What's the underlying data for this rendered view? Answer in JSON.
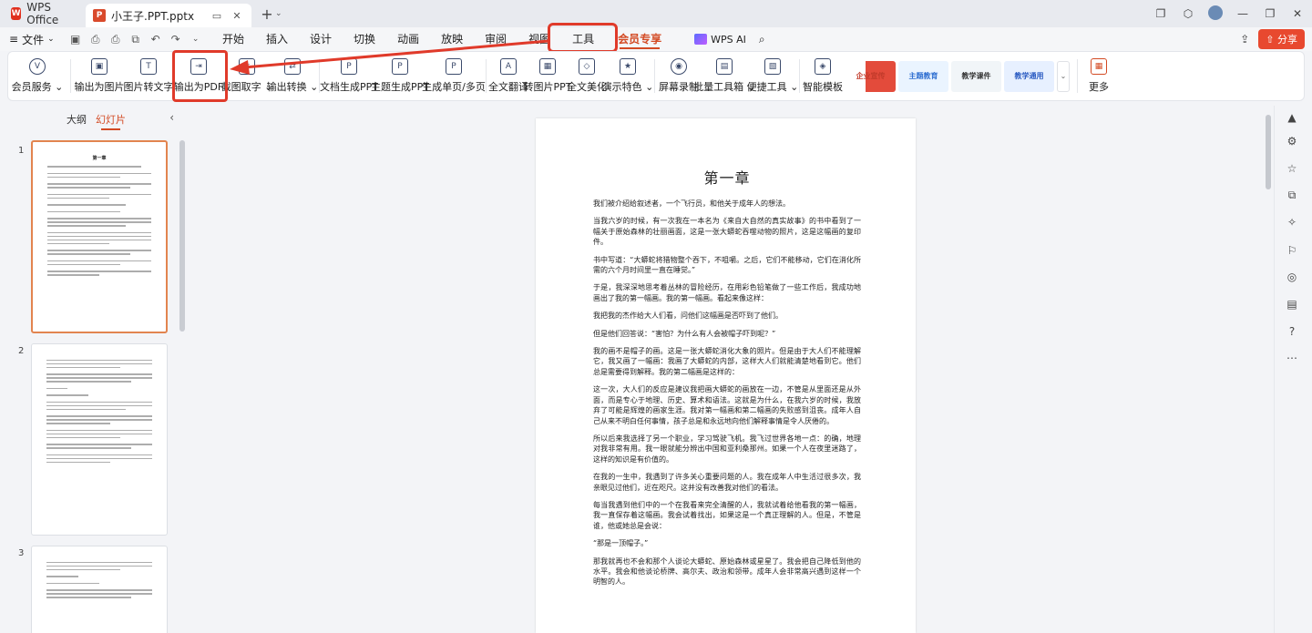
{
  "titlebar": {
    "app_name": "WPS Office",
    "app_logo": "W",
    "doc_logo": "P",
    "doc_name": "小王子.PPT.pptx",
    "icons": [
      "monitor-icon",
      "close-icon",
      "plus-icon",
      "chevron-down-icon",
      "restore-icon",
      "cube-icon",
      "avatar",
      "minimize-icon",
      "maximize-icon",
      "close-window-icon"
    ]
  },
  "menubar": {
    "file_label": "文件",
    "tabs": [
      "开始",
      "插入",
      "设计",
      "切换",
      "动画",
      "放映",
      "审阅",
      "视图",
      "工具",
      "会员专享"
    ],
    "ai_label": "WPS AI",
    "share_label": "分享"
  },
  "ribbon": {
    "buttons": [
      {
        "label": "会员服务",
        "dropdown": true,
        "glyph": "V"
      },
      {
        "label": "输出为图片",
        "glyph": "▣"
      },
      {
        "label": "图片转文字",
        "glyph": "T"
      },
      {
        "label": "输出为PDF",
        "glyph": "⇥"
      },
      {
        "label": "截图取字",
        "dropdown": true,
        "glyph": "✂"
      },
      {
        "label": "输出转换",
        "dropdown": true,
        "glyph": "⇄"
      },
      {
        "label": "文档生成PPT",
        "glyph": "P"
      },
      {
        "label": "主题生成PPT",
        "glyph": "P"
      },
      {
        "label": "生成单页/多页",
        "glyph": "P"
      },
      {
        "label": "全文翻译",
        "glyph": "A"
      },
      {
        "label": "转图片PPT",
        "glyph": "▦"
      },
      {
        "label": "全文美化",
        "glyph": "◇"
      },
      {
        "label": "演示特色",
        "dropdown": true,
        "glyph": "★"
      },
      {
        "label": "屏幕录制",
        "glyph": "◉"
      },
      {
        "label": "批量工具箱",
        "dropdown": true,
        "glyph": "▤"
      },
      {
        "label": "便捷工具",
        "dropdown": true,
        "glyph": "▧"
      },
      {
        "label": "智能模板",
        "glyph": "◈"
      },
      {
        "label": "更多",
        "glyph": "▦"
      }
    ],
    "templates": [
      "企业宣传",
      "主题教育",
      "教学课件",
      "教学通用"
    ]
  },
  "leftpanel": {
    "tab_outline": "大纲",
    "tab_slides": "幻灯片",
    "slide_numbers": [
      "1",
      "2",
      "3"
    ],
    "thumb_title": "第一章"
  },
  "slide": {
    "title": "第一章",
    "paragraphs": [
      "我们被介绍给叙述者，一个飞行员，和他关于成年人的想法。",
      "当我六岁的时候，有一次我在一本名为《来自大自然的真实故事》的书中看到了一幅关于原始森林的壮丽画面，这是一张大蟒蛇吞噬动物的照片，这是这幅画的复印件。",
      "书中写道：“大蟒蛇将猎物整个吞下，不咀嚼。之后，它们不能移动，它们在消化所需的六个月时间里一直在睡觉。”",
      "于是，我深深地思考着丛林的冒险经历，在用彩色铅笔做了一些工作后，我成功地画出了我的第一幅画。我的第一幅画。看起来像这样：",
      "我把我的杰作给大人们看，问他们这幅画是否吓到了他们。",
      "但是他们回答说：“害怕？为什么有人会被帽子吓到呢？”",
      "我的画不是帽子的画。这是一张大蟒蛇消化大象的照片。但是由于大人们不能理解它，我又画了一幅画：我画了大蟒蛇的内部，这样大人们就能清楚地看到它。他们总是需要得到解释。我的第二幅画是这样的：",
      "这一次，大人们的反应是建议我把画大蟒蛇的画放在一边，不管是从里面还是从外面，而是专心于地理、历史、算术和语法。这就是为什么，在我六岁的时候，我放弃了可能是辉煌的画家生涯。我对第一幅画和第二幅画的失败感到沮丧。成年人自己从来不明白任何事情，孩子总是和永远地向他们解释事情是令人厌倦的。",
      "所以后来我选择了另一个职业，学习驾驶飞机。我飞过世界各地一点：的确，地理对我非常有用。我一眼就能分辨出中国和亚利桑那州。如果一个人在夜里迷路了，这样的知识是有价值的。",
      "在我的一生中，我遇到了许多关心重要问题的人。我在成年人中生活过很多次，我亲眼见过他们，近在咫尺。这并没有改善我对他们的看法。",
      "每当我遇到他们中的一个在我看来完全清醒的人，我就试着给他看我的第一幅画，我一直保存着这幅画。我会试着找出，如果这是一个真正理解的人。但是，不管是谁，他或她总是会说：",
      "“那是一顶帽子。”",
      "那我就再也不会和那个人谈论大蟒蛇、原始森林或星星了。我会把自己降低到他的水平。我会和他谈论桥牌、高尔夫、政治和领带。成年人会非常高兴遇到这样一个明智的人。"
    ]
  },
  "rightrail": {
    "icons": [
      "sliders-icon",
      "star-icon",
      "layers-icon",
      "magic-wand-icon",
      "shirt-icon",
      "animation-icon",
      "book-icon",
      "help-icon",
      "more-icon"
    ]
  },
  "colors": {
    "accent": "#d34a23",
    "highlight": "#e03a2a"
  }
}
